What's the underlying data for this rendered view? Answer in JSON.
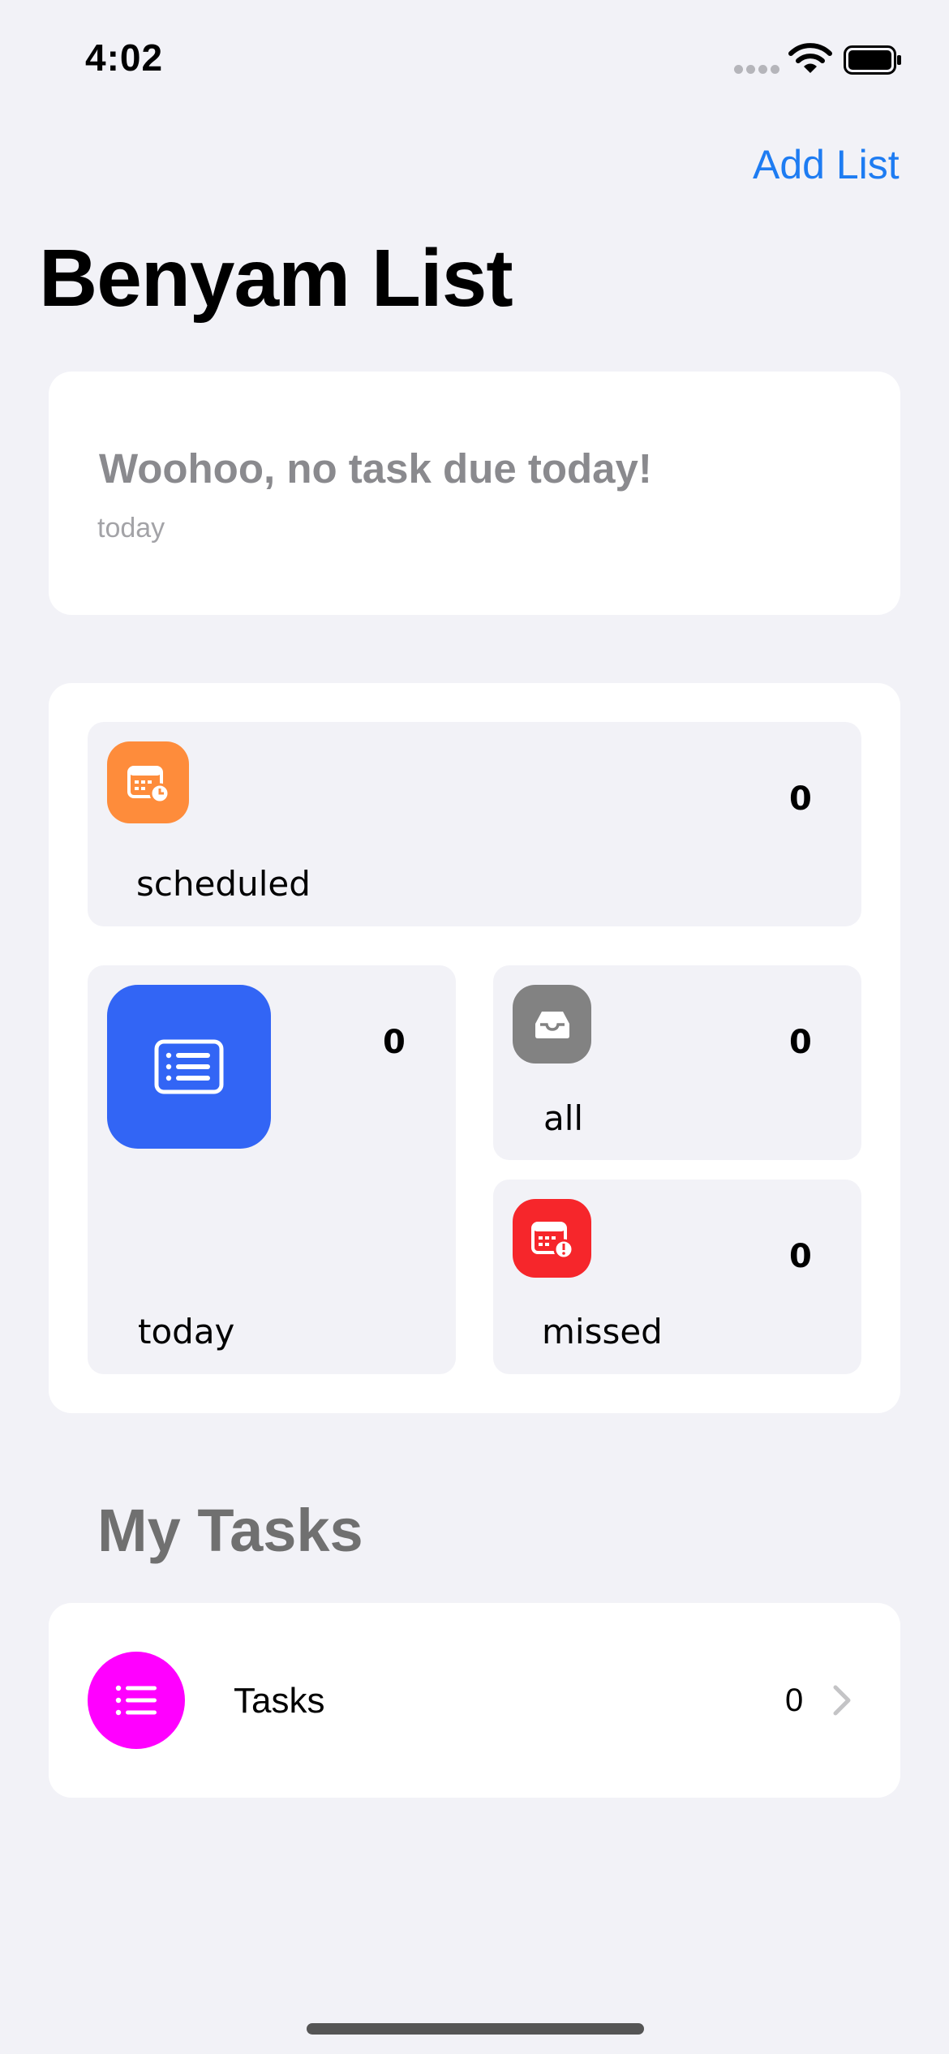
{
  "status_bar": {
    "time": "4:02",
    "icons": [
      "signal-dots-icon",
      "wifi-icon",
      "battery-icon"
    ]
  },
  "nav": {
    "add_list_label": "Add List"
  },
  "header": {
    "title": "Benyam List"
  },
  "today_card": {
    "message": "Woohoo, no task due today!",
    "subtitle": "today"
  },
  "smart_lists": {
    "scheduled": {
      "label": "scheduled",
      "count": "0",
      "icon": "calendar-clock-icon",
      "color": "#FE8C3B"
    },
    "today": {
      "label": "today",
      "count": "0",
      "icon": "list-document-icon",
      "color": "#3265F5"
    },
    "all": {
      "label": "all",
      "count": "0",
      "icon": "tray-icon",
      "color": "#828282"
    },
    "missed": {
      "label": "missed",
      "count": "0",
      "icon": "calendar-exclamation-icon",
      "color": "#F6262B"
    }
  },
  "my_tasks": {
    "heading": "My Tasks",
    "lists": [
      {
        "name": "Tasks",
        "count": "0",
        "icon": "list-bullet-icon",
        "color": "#FF00FF"
      }
    ]
  },
  "colors": {
    "accent": "#1E7CF2",
    "background": "#F2F2F7"
  }
}
